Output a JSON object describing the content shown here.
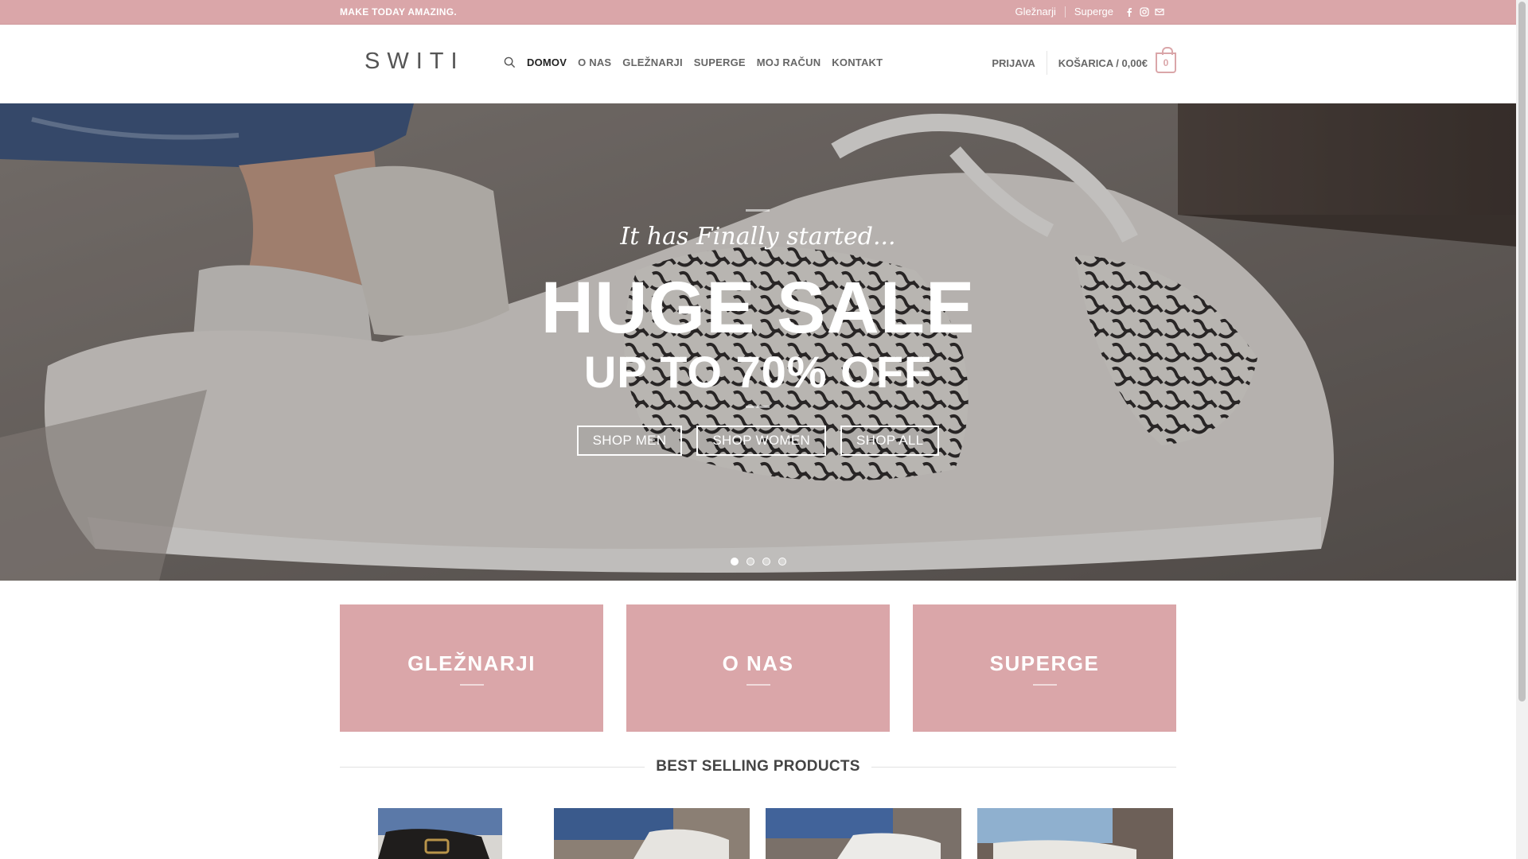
{
  "topbar": {
    "tagline": "MAKE TODAY AMAZING.",
    "links": [
      "Gležnarji",
      "Superge"
    ],
    "icons": [
      "facebook-icon",
      "instagram-icon",
      "mail-icon"
    ]
  },
  "header": {
    "logo": "SWITI",
    "nav": [
      "DOMOV",
      "O NAS",
      "GLEŽNARJI",
      "SUPERGE",
      "MOJ RAČUN",
      "KONTAKT"
    ],
    "login": "PRIJAVA",
    "cart_label": "KOŠARICA / 0,00€",
    "cart_count": "0"
  },
  "hero": {
    "script": "It has Finally started...",
    "headline": "HUGE SALE",
    "subline": "UP TO 70% OFF",
    "buttons": [
      "SHOP MEN",
      "SHOP WOMEN",
      "SHOP ALL"
    ],
    "slides": 4,
    "active_slide": 1
  },
  "banners": [
    "GLEŽNARJI",
    "O NAS",
    "SUPERGE"
  ],
  "section_title": "BEST SELLING PRODUCTS",
  "colors": {
    "accent": "#daa6a9",
    "text": "#333333"
  }
}
